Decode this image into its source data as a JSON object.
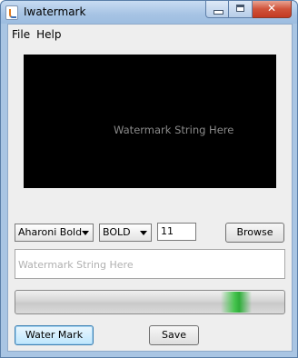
{
  "window": {
    "title": "Iwatermark",
    "icon": "java-cup-icon"
  },
  "menu": {
    "items": [
      {
        "label": "File"
      },
      {
        "label": "Help"
      }
    ]
  },
  "preview": {
    "text": "Watermark String Here",
    "background": "#000000",
    "text_color": "#8a8a8a"
  },
  "controls": {
    "font_family": {
      "value": "Aharoni Bold"
    },
    "font_style": {
      "value": "BOLD"
    },
    "font_size": {
      "value": "11"
    },
    "browse_label": "Browse",
    "watermark_input": {
      "placeholder": "Watermark String Here"
    },
    "progress": {
      "indeterminate": true,
      "accent": "#2fae3a"
    },
    "watermark_button_label": "Water Mark",
    "save_button_label": "Save"
  }
}
